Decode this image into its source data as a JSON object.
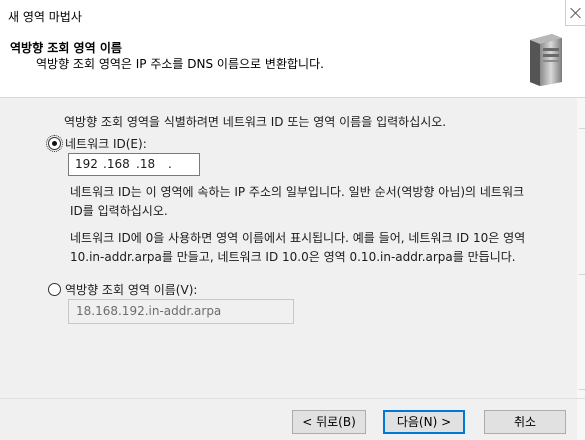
{
  "window": {
    "title": "새 영역 마법사"
  },
  "header": {
    "title": "역방향 조회 영역 이름",
    "subtitle": "역방향 조회 영역은 IP 주소를 DNS 이름으로 변환합니다."
  },
  "main": {
    "instruction": "역방향 조회 영역을 식별하려면 네트워크 ID 또는 영역 이름을 입력하십시오.",
    "network_id": {
      "label": "네트워크 ID(E):",
      "checked": true,
      "octets": [
        "192",
        ".168",
        ".18",
        "."
      ],
      "help1_line1": "네트워크 ID는 이 영역에 속하는 IP 주소의 일부입니다. 일반 순서(역방향 아님)의 네트워크",
      "help1_line2": "ID를 입력하십시오.",
      "help2_line1": "네트워크 ID에 0을 사용하면 영역 이름에서 표시됩니다. 예를 들어, 네트워크 ID 10은 영역",
      "help2_line2": "10.in-addr.arpa를 만들고, 네트워크 ID 10.0은 영역 0.10.in-addr.arpa를 만듭니다."
    },
    "zone_name": {
      "label": "역방향 조회 영역 이름(V):",
      "checked": false,
      "value": "18.168.192.in-addr.arpa"
    }
  },
  "footer": {
    "back_label": "< 뒤로(B)",
    "next_label": "다음(N) >",
    "cancel_label": "취소"
  },
  "colors": {
    "accent": "#0078d7",
    "window_bg": "#f0f0f0",
    "header_bg": "#ffffff"
  },
  "icons": [
    "close-icon",
    "server-icon"
  ]
}
